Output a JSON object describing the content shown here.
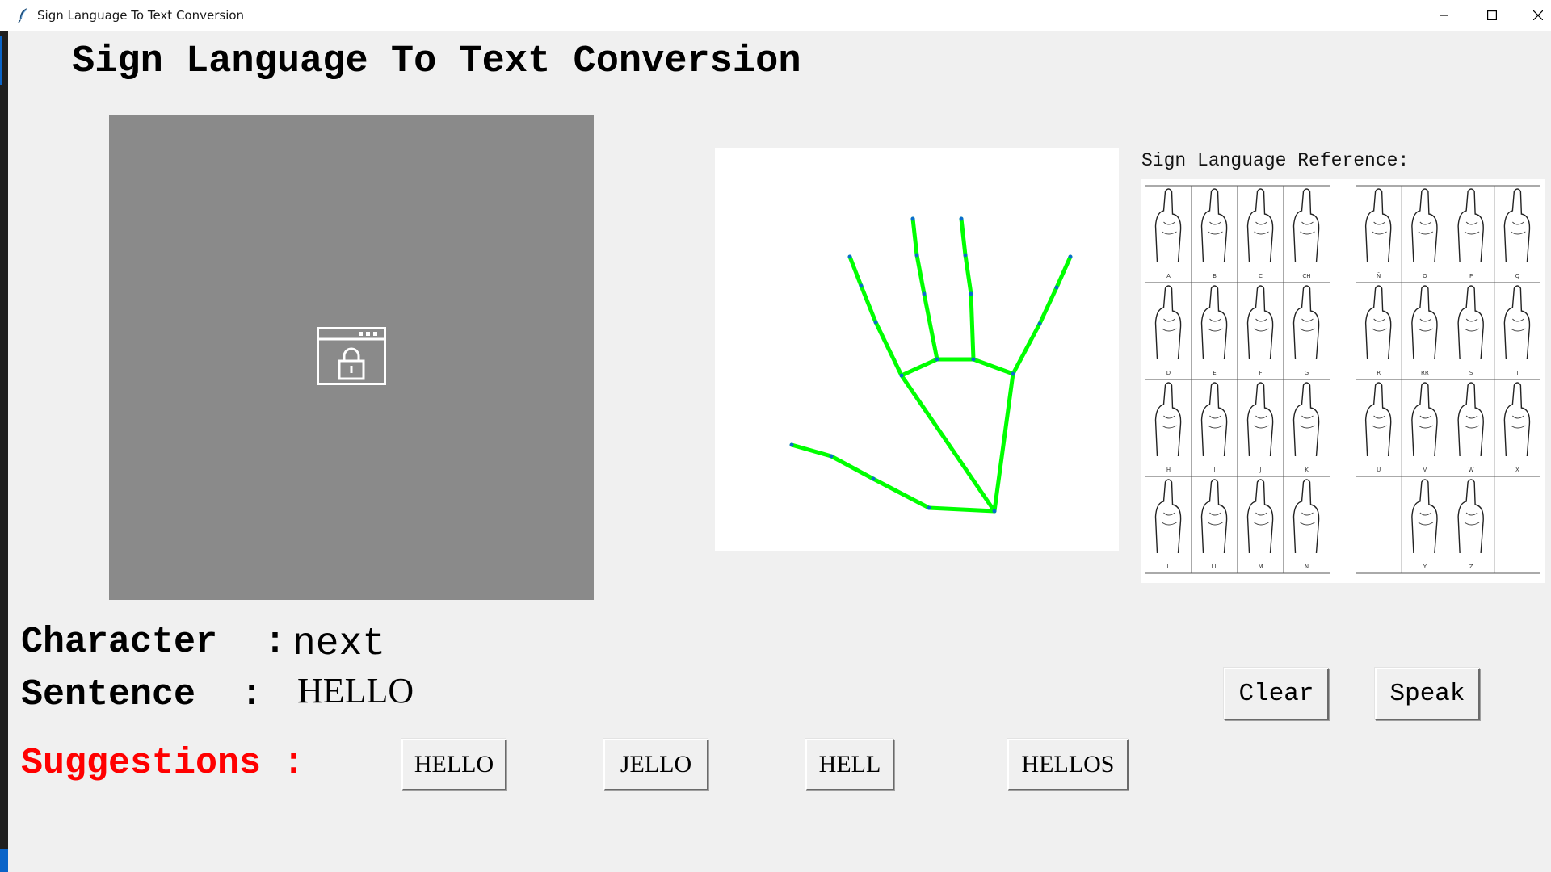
{
  "window": {
    "title": "Sign Language To Text Conversion",
    "minimize_icon": "minimize-icon",
    "maximize_icon": "maximize-icon",
    "close_icon": "close-icon"
  },
  "heading": "Sign Language To Text Conversion",
  "camera_feed": {
    "icon": "camera-locked-icon",
    "background_color": "#8a8a8a"
  },
  "hand_skeleton": {
    "line_color": "#00ff00",
    "point_color": "#0a6ccf"
  },
  "reference": {
    "label": "Sign Language Reference:",
    "letters_left": [
      "A",
      "B",
      "C",
      "CH",
      "D",
      "E",
      "F",
      "G",
      "H",
      "I",
      "J",
      "K",
      "L",
      "LL",
      "M",
      "N"
    ],
    "letters_right": [
      "Ñ",
      "O",
      "P",
      "Q",
      "R",
      "RR",
      "S",
      "T",
      "U",
      "V",
      "W",
      "X",
      "",
      "Y",
      "Z",
      ""
    ]
  },
  "character": {
    "label": "Character",
    "colon": ":",
    "value": "next"
  },
  "sentence": {
    "label": "Sentence",
    "colon": ":",
    "value": "HELLO"
  },
  "suggestions": {
    "label": "Suggestions :",
    "color": "#ff0000",
    "items": [
      "HELLO",
      "JELLO",
      "HELL",
      "HELLOS"
    ]
  },
  "actions": {
    "clear": "Clear",
    "speak": "Speak"
  }
}
